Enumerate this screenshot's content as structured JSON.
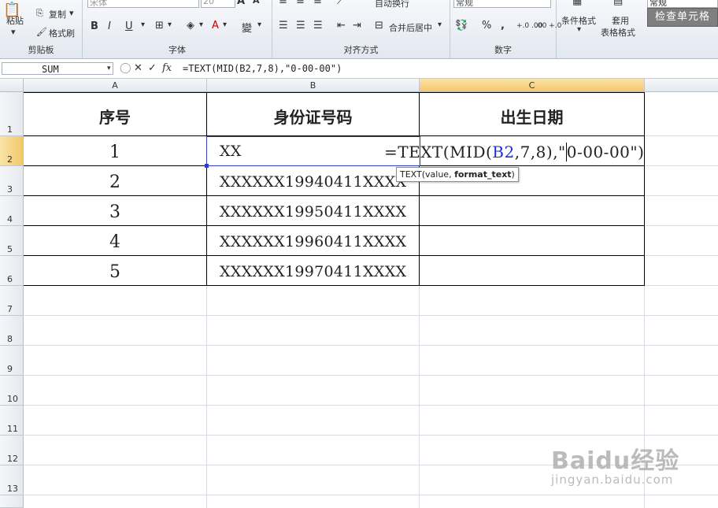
{
  "ribbon": {
    "clipboard": {
      "paste": "粘贴",
      "copy": "复制",
      "format_painter": "格式刷",
      "label": "剪贴板"
    },
    "font": {
      "font_name": "宋体",
      "font_size": "20",
      "bold": "B",
      "italic": "I",
      "underline": "U",
      "phonetic": "wén",
      "label": "字体"
    },
    "alignment": {
      "wrap": "自动换行",
      "merge": "合并后居中",
      "label": "对齐方式"
    },
    "number": {
      "format": "常规",
      "percent": "%",
      "comma": ",",
      "inc_dec": "+.0 .00",
      "dec_dec": ".00 +.0",
      "label": "数字"
    },
    "styles": {
      "conditional": "条件格式",
      "table_a": "套用",
      "table_b": "表格格式",
      "normal": "常规",
      "check_cell": "检查单元格"
    }
  },
  "formula_bar": {
    "name_box": "SUM",
    "cancel": "✕",
    "enter": "✓",
    "fx": "fx",
    "formula": "=TEXT(MID(B2,7,8),\"0-00-00\")"
  },
  "columns": [
    "A",
    "B",
    "C"
  ],
  "rows": [
    "1",
    "2",
    "3",
    "4",
    "5",
    "6",
    "7",
    "8",
    "9",
    "10",
    "11",
    "12",
    "13"
  ],
  "table": {
    "headers": [
      "序号",
      "身份证号码",
      "出生日期"
    ],
    "data": [
      {
        "seq": "1",
        "id": "XX"
      },
      {
        "seq": "2",
        "id": "XXXXXX19940411XXXX"
      },
      {
        "seq": "3",
        "id": "XXXXXX19950411XXXX"
      },
      {
        "seq": "4",
        "id": "XXXXXX19960411XXXX"
      },
      {
        "seq": "5",
        "id": "XXXXXX19970411XXXX"
      }
    ]
  },
  "edit": {
    "f1": "=TEXT(MID(",
    "ref": "B2",
    "f2": ",7,8)",
    "f3": ",\"",
    "f4": "0-00-00\")"
  },
  "tooltip": {
    "func": "TEXT(value, ",
    "arg": "format_text",
    "close": ")"
  },
  "watermark": {
    "brand": "Baidu经验",
    "url": "jingyan.baidu.com"
  },
  "colors": {
    "ref_blue": "#1f2fd6",
    "paren_green": "#2f8f2f",
    "selection": "#2b3fbf",
    "header_highlight": "#f4c76a"
  }
}
